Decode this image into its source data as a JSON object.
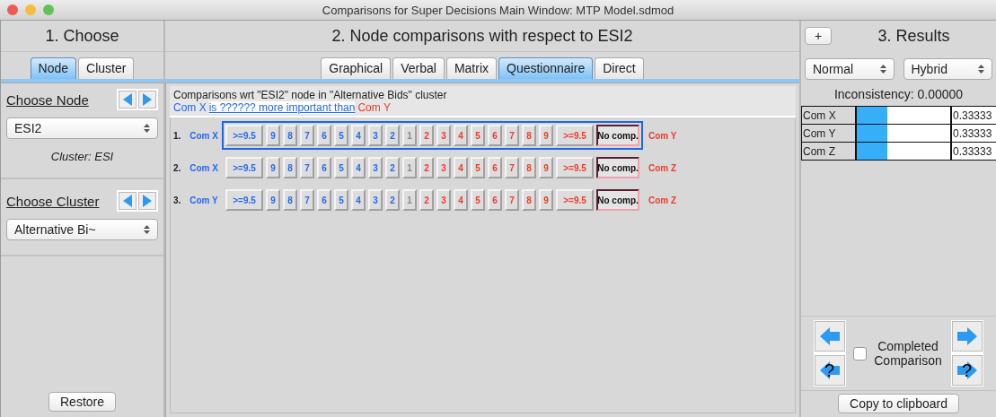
{
  "window": {
    "title": "Comparisons for Super Decisions Main Window: MTP Model.sdmod"
  },
  "choose": {
    "title": "1. Choose",
    "tabs": [
      {
        "label": "Node",
        "selected": true
      },
      {
        "label": "Cluster",
        "selected": false
      }
    ],
    "node_label": "Choose Node",
    "node_value": "ESI2",
    "cluster_note": "Cluster: ESI",
    "cluster_label": "Choose Cluster",
    "cluster_value": "Alternative Bi~",
    "restore": "Restore"
  },
  "comparisons": {
    "title": "2. Node comparisons with respect to ESI2",
    "tabs": [
      {
        "label": "Graphical",
        "selected": false
      },
      {
        "label": "Verbal",
        "selected": false
      },
      {
        "label": "Matrix",
        "selected": false
      },
      {
        "label": "Questionnaire",
        "selected": true
      },
      {
        "label": "Direct",
        "selected": false
      }
    ],
    "heading": "Comparisons wrt \"ESI2\" node in \"Alternative Bids\" cluster",
    "question": {
      "left": "Com X",
      "link": "is ?????? more important than",
      "right": "Com Y"
    },
    "rows": [
      {
        "number": "1.",
        "left": "Com X",
        "right": "Com Y",
        "selected": true,
        "buttons": [
          {
            "label": ">=9.5",
            "kind": "left"
          },
          {
            "label": "9",
            "kind": "left"
          },
          {
            "label": "8",
            "kind": "left"
          },
          {
            "label": "7",
            "kind": "left"
          },
          {
            "label": "6",
            "kind": "left"
          },
          {
            "label": "5",
            "kind": "left"
          },
          {
            "label": "4",
            "kind": "left"
          },
          {
            "label": "3",
            "kind": "left"
          },
          {
            "label": "2",
            "kind": "left"
          },
          {
            "label": "1",
            "kind": "equal"
          },
          {
            "label": "2",
            "kind": "right"
          },
          {
            "label": "3",
            "kind": "right"
          },
          {
            "label": "4",
            "kind": "right"
          },
          {
            "label": "5",
            "kind": "right"
          },
          {
            "label": "6",
            "kind": "right"
          },
          {
            "label": "7",
            "kind": "right"
          },
          {
            "label": "8",
            "kind": "right"
          },
          {
            "label": "9",
            "kind": "right"
          },
          {
            "label": ">=9.5",
            "kind": "right"
          },
          {
            "label": "No comp.",
            "kind": "none"
          }
        ]
      },
      {
        "number": "2.",
        "left": "Com X",
        "right": "Com Z",
        "selected": false,
        "buttons": [
          {
            "label": ">=9.5",
            "kind": "left"
          },
          {
            "label": "9",
            "kind": "left"
          },
          {
            "label": "8",
            "kind": "left"
          },
          {
            "label": "7",
            "kind": "left"
          },
          {
            "label": "6",
            "kind": "left"
          },
          {
            "label": "5",
            "kind": "left"
          },
          {
            "label": "4",
            "kind": "left"
          },
          {
            "label": "3",
            "kind": "left"
          },
          {
            "label": "2",
            "kind": "left"
          },
          {
            "label": "1",
            "kind": "equal"
          },
          {
            "label": "2",
            "kind": "right"
          },
          {
            "label": "3",
            "kind": "right"
          },
          {
            "label": "4",
            "kind": "right"
          },
          {
            "label": "5",
            "kind": "right"
          },
          {
            "label": "6",
            "kind": "right"
          },
          {
            "label": "7",
            "kind": "right"
          },
          {
            "label": "8",
            "kind": "right"
          },
          {
            "label": "9",
            "kind": "right"
          },
          {
            "label": ">=9.5",
            "kind": "right"
          },
          {
            "label": "No comp.",
            "kind": "none"
          }
        ]
      },
      {
        "number": "3.",
        "left": "Com Y",
        "right": "Com Z",
        "selected": false,
        "buttons": [
          {
            "label": ">=9.5",
            "kind": "left"
          },
          {
            "label": "9",
            "kind": "left"
          },
          {
            "label": "8",
            "kind": "left"
          },
          {
            "label": "7",
            "kind": "left"
          },
          {
            "label": "6",
            "kind": "left"
          },
          {
            "label": "5",
            "kind": "left"
          },
          {
            "label": "4",
            "kind": "left"
          },
          {
            "label": "3",
            "kind": "left"
          },
          {
            "label": "2",
            "kind": "left"
          },
          {
            "label": "1",
            "kind": "equal"
          },
          {
            "label": "2",
            "kind": "right"
          },
          {
            "label": "3",
            "kind": "right"
          },
          {
            "label": "4",
            "kind": "right"
          },
          {
            "label": "5",
            "kind": "right"
          },
          {
            "label": "6",
            "kind": "right"
          },
          {
            "label": "7",
            "kind": "right"
          },
          {
            "label": "8",
            "kind": "right"
          },
          {
            "label": "9",
            "kind": "right"
          },
          {
            "label": ">=9.5",
            "kind": "right"
          },
          {
            "label": "No comp.",
            "kind": "none"
          }
        ]
      }
    ]
  },
  "results": {
    "add_button": "+",
    "title": "3. Results",
    "mode": "Normal",
    "method": "Hybrid",
    "inconsistency": "Inconsistency: 0.00000",
    "rows": [
      {
        "name": "Com X",
        "level": 0.33,
        "value": "0.33333"
      },
      {
        "name": "Com Y",
        "level": 0.33,
        "value": "0.33333"
      },
      {
        "name": "Com Z",
        "level": 0.33,
        "value": "0.33333"
      }
    ],
    "help_mark_left": "?",
    "help_mark_right": "?",
    "completed": {
      "label": "Completed Comparison",
      "checked": false
    },
    "copy": "Copy to clipboard"
  }
}
